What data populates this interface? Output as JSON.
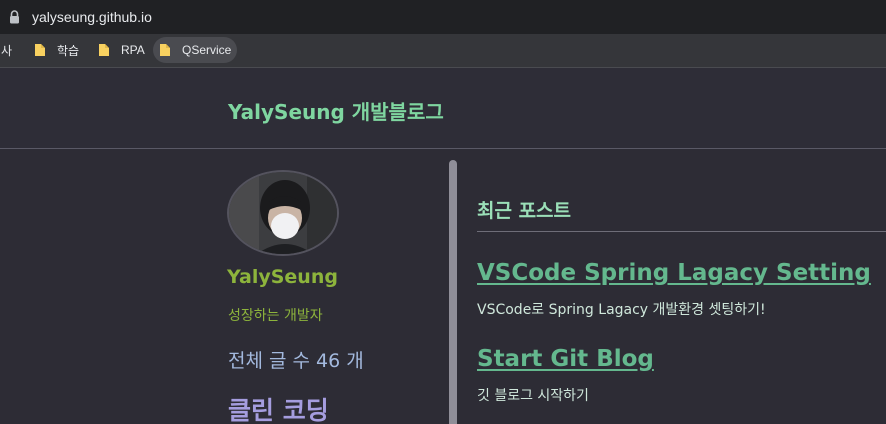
{
  "browser": {
    "url": "yalyseung.github.io",
    "bookmarks": [
      {
        "label": "회사"
      },
      {
        "label": "학습"
      },
      {
        "label": "RPA"
      },
      {
        "label": "QService"
      }
    ]
  },
  "site": {
    "title": "YalySeung 개발블로그"
  },
  "sidebar": {
    "author_name": "YalySeung",
    "author_bio": "성장하는 개발자",
    "post_count": "전체 글 수 46 개",
    "category_title": "클린 코딩"
  },
  "main": {
    "section_title": "최근 포스트",
    "posts": [
      {
        "title": "VSCode Spring Lagacy Setting",
        "excerpt": "VSCode로 Spring Lagacy 개발환경 셋팅하기!"
      },
      {
        "title": "Start Git Blog",
        "excerpt": "깃 블로그 시작하기"
      }
    ]
  },
  "colors": {
    "page_background": "#2d2c35",
    "site_title": "#7fd6a0",
    "author_name": "#8db43c",
    "post_count": "#a3b9de",
    "category_title": "#a59ddf",
    "post_title": "#64b88e"
  }
}
